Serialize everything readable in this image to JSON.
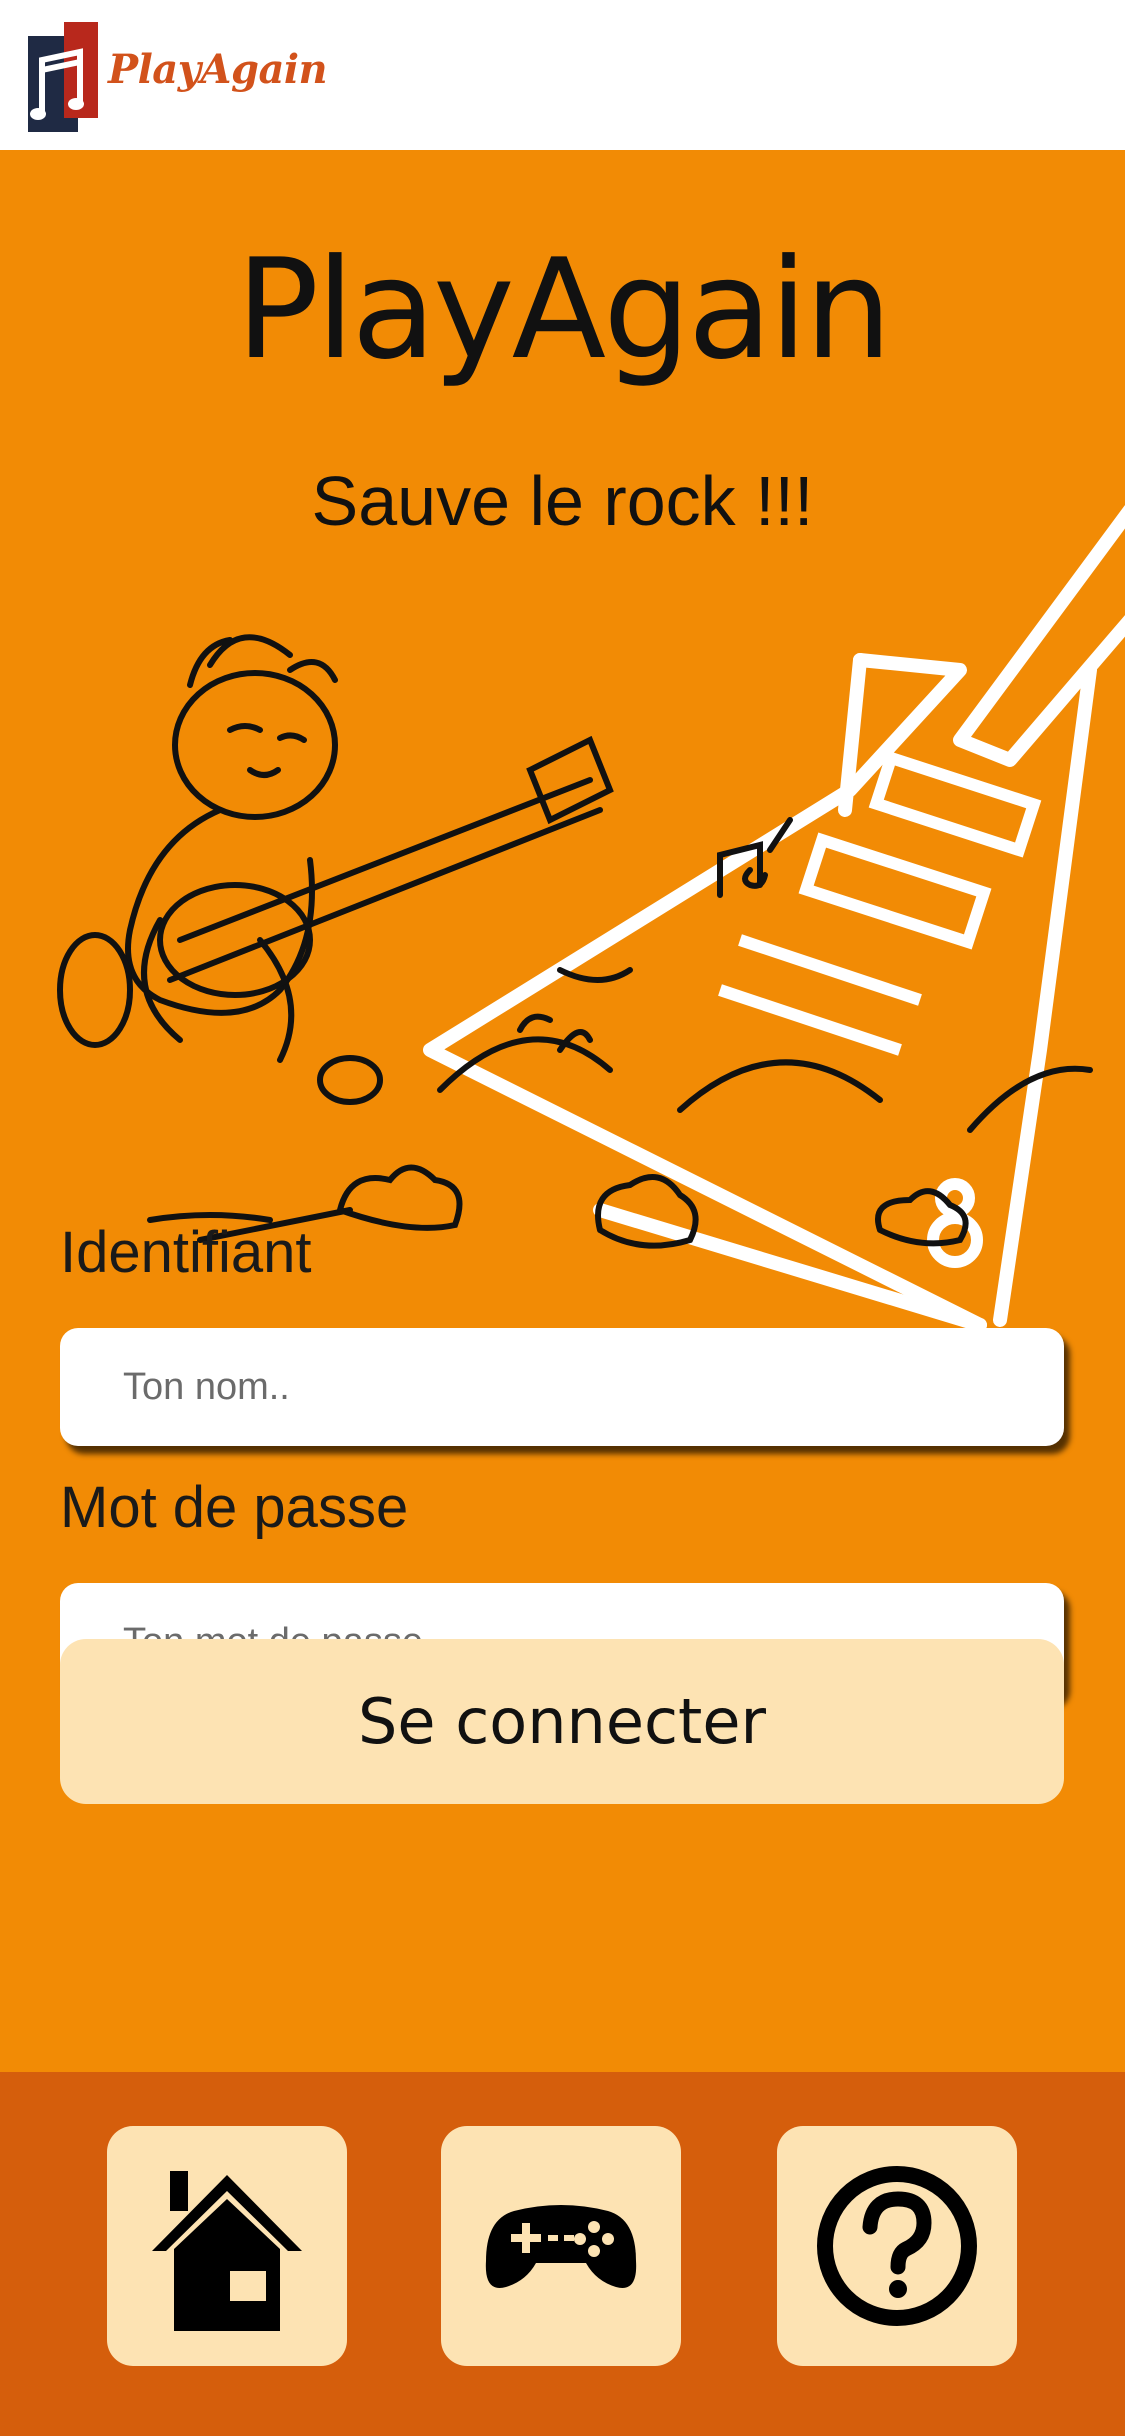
{
  "header": {
    "logo_text": "PlayAgain"
  },
  "hero": {
    "title": "PlayAgain",
    "tagline": "Sauve le rock !!!"
  },
  "form": {
    "username_label": "Identifiant",
    "username_placeholder": "Ton nom..",
    "password_label": "Mot de passe",
    "password_placeholder": "Ton mot de passe..",
    "submit_label": "Se connecter"
  },
  "nav": {
    "items": [
      {
        "icon": "home-icon"
      },
      {
        "icon": "gamepad-icon"
      },
      {
        "icon": "help-icon"
      }
    ]
  },
  "colors": {
    "background": "#f28b05",
    "bottom_bar": "#d55e0c",
    "button_fill": "#fde3b3",
    "logo_red": "#c0392b",
    "logo_navy": "#1f2a44",
    "logo_text": "#d2521b"
  }
}
